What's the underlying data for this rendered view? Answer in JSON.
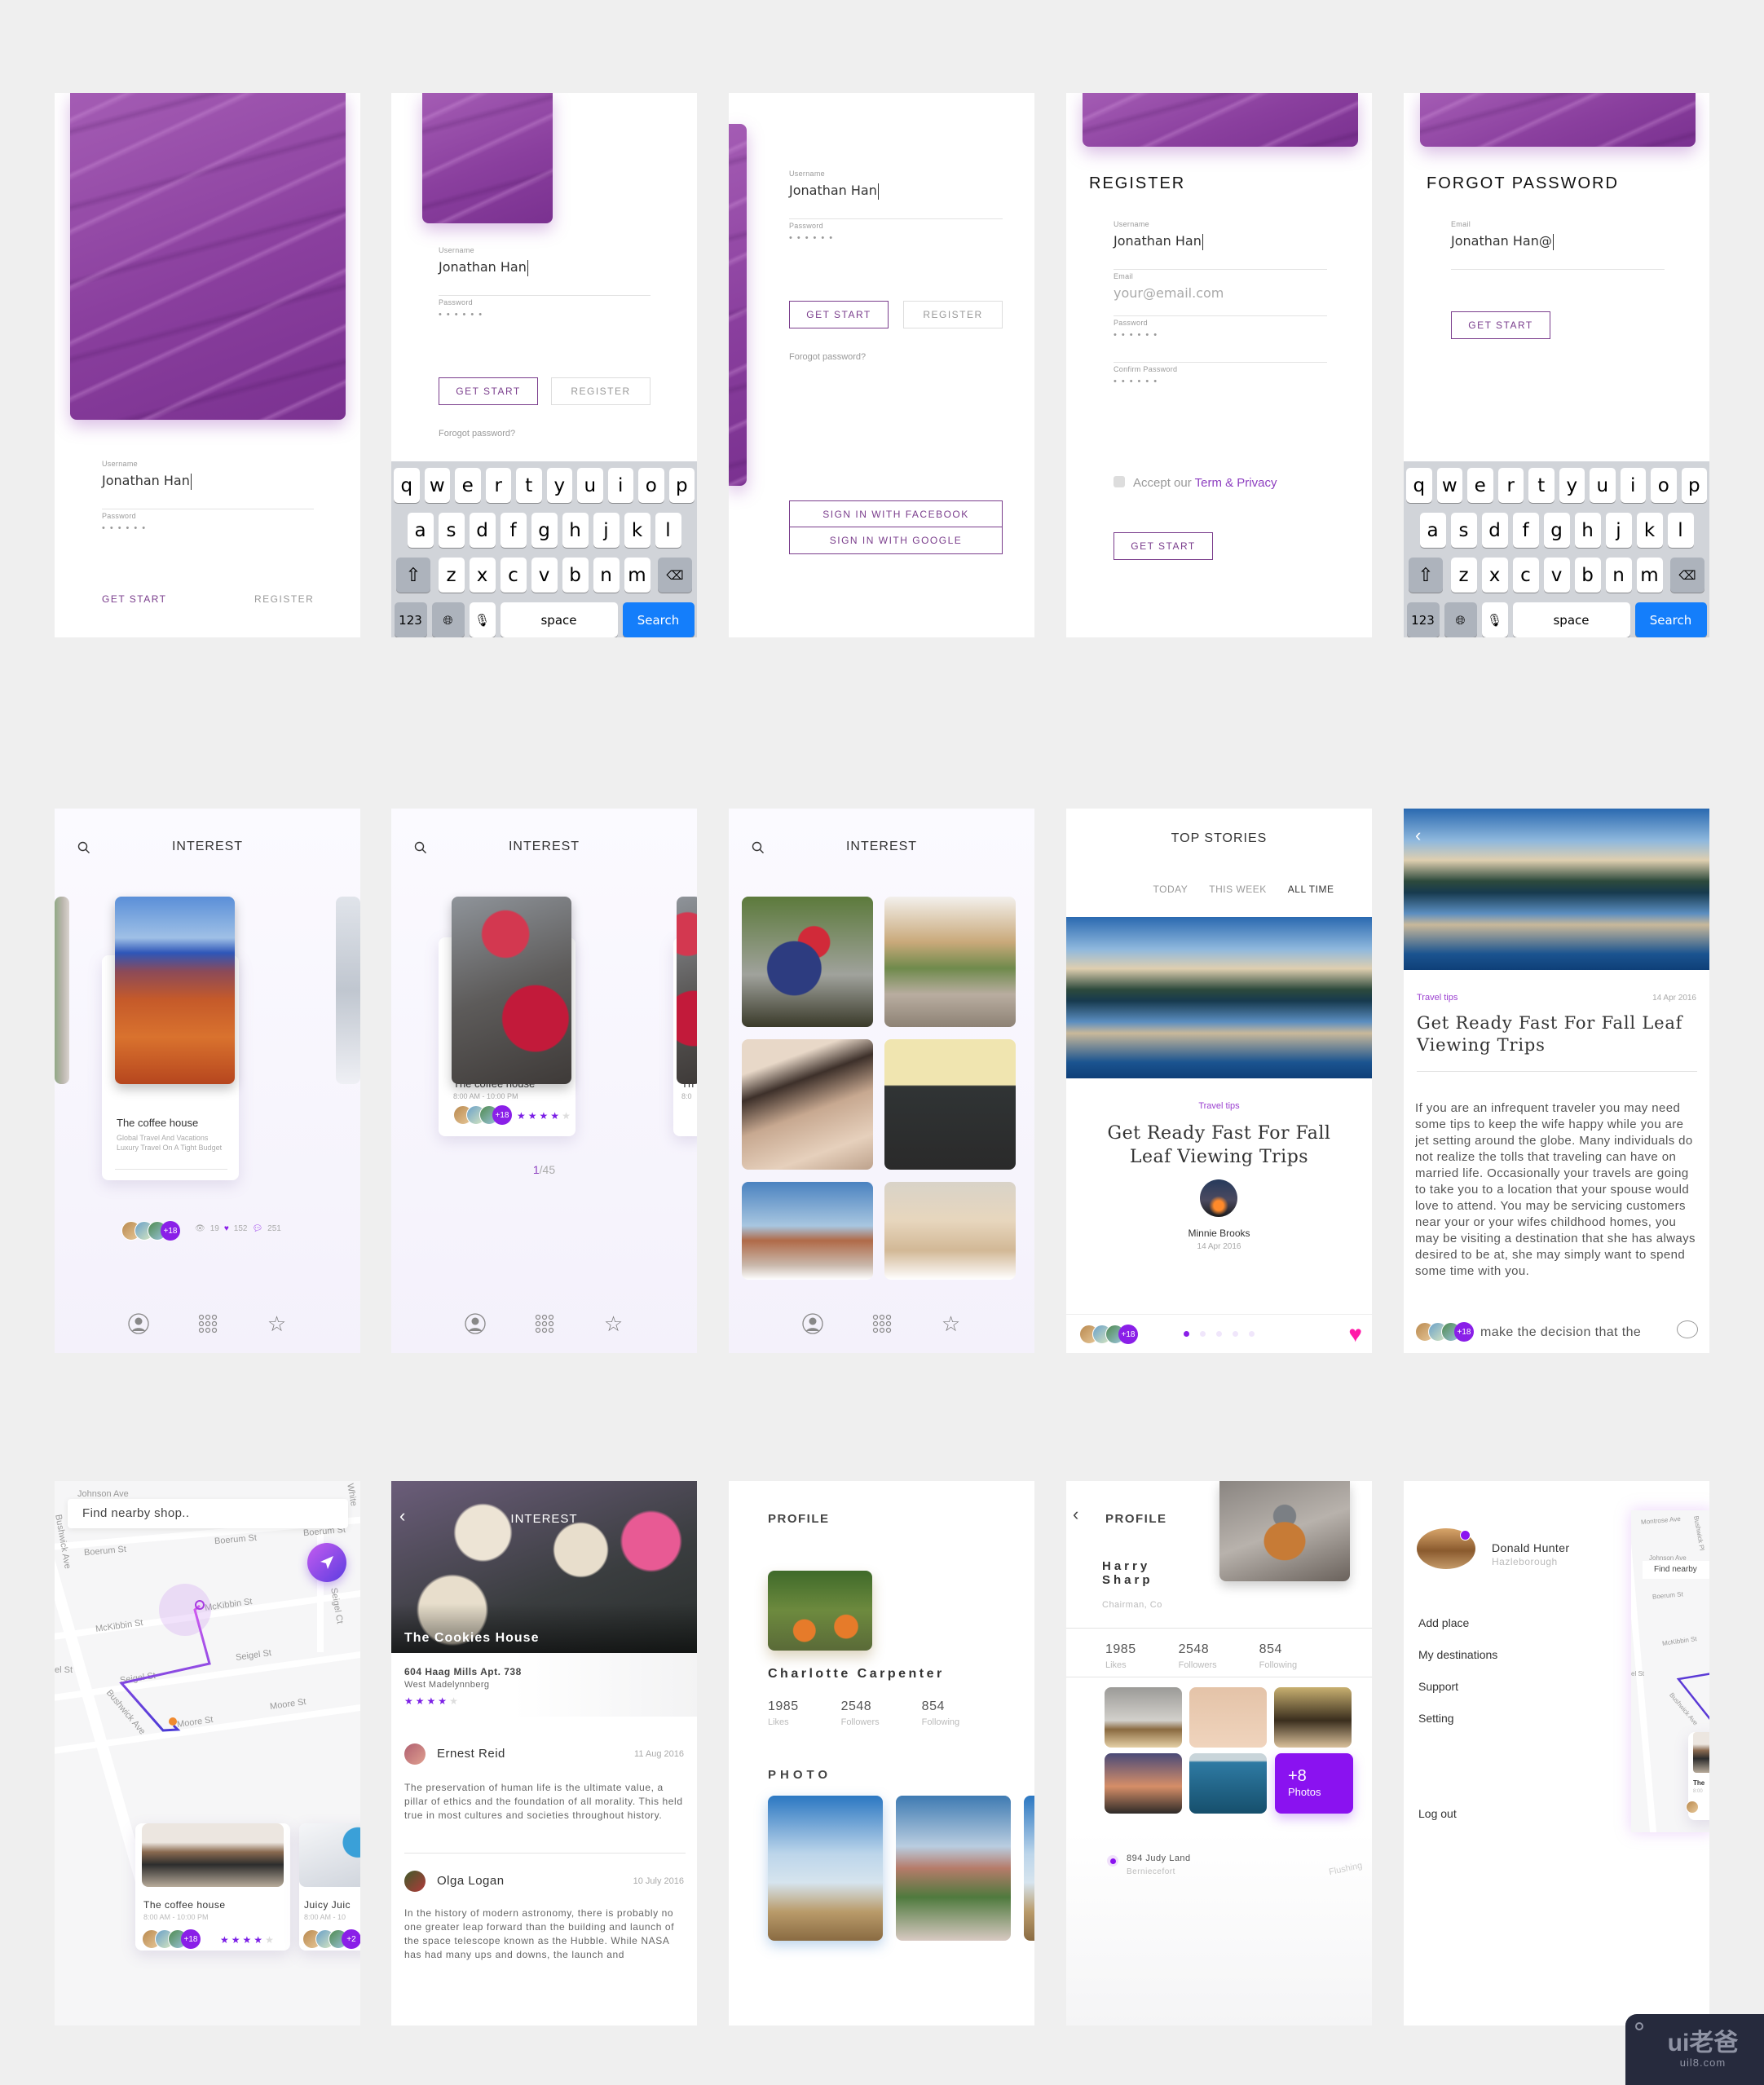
{
  "login_screen": {
    "username_label": "Username",
    "username_value": "Jonathan Han",
    "password_label": "Password",
    "password_mask": "••••••",
    "get_start": "GET START",
    "register": "REGISTER"
  },
  "login_keyboard_screen": {
    "username_label": "Username",
    "username_value": "Jonathan Han",
    "password_label": "Password",
    "password_mask": "••••••",
    "get_start": "GET START",
    "register": "REGISTER",
    "forgot": "Forogot password?"
  },
  "social_login_screen": {
    "username_label": "Username",
    "username_value": "Jonathan Han",
    "password_label": "Password",
    "password_mask": "••••••",
    "get_start": "GET START",
    "register": "REGISTER",
    "forgot": "Forogot password?",
    "facebook": "SIGN IN WITH FACEBOOK",
    "google": "SIGN IN WITH GOOGLE"
  },
  "register_screen": {
    "title": "REGISTER",
    "username_label": "Username",
    "username_value": "Jonathan Han",
    "email_label": "Email",
    "email_placeholder": "your@email.com",
    "password_label": "Password",
    "password_mask": "••••••",
    "confirm_label": "Confirm Password",
    "confirm_mask": "••••••",
    "accept_text": "Accept our ",
    "terms_link": "Term & Privacy",
    "get_start": "GET START"
  },
  "forgot_screen": {
    "title": "FORGOT PASSWORD",
    "email_label": "Email",
    "email_value": "Jonathan Han@",
    "get_start": "GET START"
  },
  "keyboard": {
    "row1": [
      "q",
      "w",
      "e",
      "r",
      "t",
      "y",
      "u",
      "i",
      "o",
      "p"
    ],
    "row2": [
      "a",
      "s",
      "d",
      "f",
      "g",
      "h",
      "j",
      "k",
      "l"
    ],
    "row3": [
      "z",
      "x",
      "c",
      "v",
      "b",
      "n",
      "m"
    ],
    "numbers": "123",
    "space": "space",
    "search": "Search"
  },
  "interest_carousel": {
    "title": "INTEREST",
    "card_title": "The coffee house",
    "card_desc": "Global Travel And Vacations Luxury Travel On A Tight Budget",
    "plus_count": "+18",
    "views": "19",
    "likes": "152",
    "comments": "251"
  },
  "interest_carousel2": {
    "title": "INTEREST",
    "card_title": "The coffee house",
    "card_hours": "8:00 AM - 10:00 PM",
    "plus_count": "+18",
    "rating": 4,
    "rating_max": 5,
    "peek_title": "Th",
    "peek_hours": "8:0",
    "pager_current": "1",
    "pager_total": "/45"
  },
  "interest_grid": {
    "title": "INTEREST"
  },
  "top_stories": {
    "title": "TOP STORIES",
    "tabs": [
      "TODAY",
      "THIS WEEK",
      "ALL TIME"
    ],
    "active_tab": "ALL TIME",
    "category": "Travel tips",
    "headline": "Get Ready Fast For Fall Leaf Viewing Trips",
    "author": "Minnie Brooks",
    "date": "14 Apr 2016",
    "plus_count": "+18",
    "page_dots": 5,
    "active_dot": 1
  },
  "article": {
    "category": "Travel tips",
    "date": "14 Apr 2016",
    "headline": "Get Ready Fast For Fall Leaf Viewing Trips",
    "body": "If you are an infrequent traveler you may need some tips to keep the wife happy while you are jet setting around the globe. Many individuals do not realize the tolls that traveling can have on married life. Occasionally your travels are going to take you to a location that your spouse would love to attend. You may be servicing customers near your or your wifes childhood homes, you may be visiting a destination that she has always desired to be at, she may simply want to spend some time with you.",
    "footer_text": "make the decision that the",
    "plus_count": "+18"
  },
  "map_screen": {
    "search_placeholder": "Find nearby shop..",
    "streets": [
      "Johnson Ave",
      "Boerum St",
      "Boerum St",
      "Boerum St",
      "McKibbin St",
      "McKibbin St",
      "Seigel St",
      "Seigel St",
      "el St",
      "Moore St",
      "Moore St",
      "Bushwick Ave",
      "Bushwick Ave",
      "Seigel Ct",
      "White"
    ],
    "cards": [
      {
        "title": "The coffee house",
        "hours": "8:00 AM - 10:00 PM",
        "plus": "+18",
        "rating": 4
      },
      {
        "title": "Juicy Juic",
        "hours": "8:00 AM - 10",
        "plus": "+2"
      }
    ]
  },
  "place_detail": {
    "header": "INTEREST",
    "place_name": "The Cookies House",
    "address_line1": "604 Haag Mills Apt. 738",
    "address_line2": "West Madelynnberg",
    "rating": 4,
    "reviews": [
      {
        "name": "Ernest Reid",
        "date": "11 Aug 2016",
        "text": "The preservation of human life is the ultimate value, a pillar of ethics and the foundation of all morality. This held true in most cultures and societies throughout history."
      },
      {
        "name": "Olga Logan",
        "date": "10 July 2016",
        "text": "In the history of modern astronomy, there is probably no one greater leap forward than the building and launch of the space telescope known as the Hubble. While NASA has had many ups and downs, the launch and"
      }
    ]
  },
  "profile1": {
    "title": "PROFILE",
    "name": "Charlotte Carpenter",
    "stats": [
      {
        "value": "1985",
        "label": "Likes"
      },
      {
        "value": "2548",
        "label": "Followers"
      },
      {
        "value": "854",
        "label": "Following"
      }
    ],
    "photo_heading": "PHOTO"
  },
  "profile2": {
    "title": "PROFILE",
    "first_name": "Harry",
    "last_name": "Sharp",
    "role": "Chairman, Co",
    "stats": [
      {
        "value": "1985",
        "label": "Likes"
      },
      {
        "value": "2548",
        "label": "Followers"
      },
      {
        "value": "854",
        "label": "Following"
      }
    ],
    "more_count": "+8",
    "more_label": "Photos",
    "address_line1": "894 Judy Land",
    "address_line2": "Berniecefort",
    "map_label": "Flushing"
  },
  "side_menu": {
    "name": "Donald Hunter",
    "location": "Hazleborough",
    "items": [
      "Add place",
      "My destinations",
      "Support",
      "Setting"
    ],
    "logout": "Log out",
    "peek_search": "Find nearby",
    "peek_streets": [
      "Montrose Ave",
      "Johnson Ave",
      "Boerum St",
      "McKibbin St",
      "el St",
      "Bushwick Ave",
      "Bushwick Pl"
    ],
    "peek_card_title": "The",
    "peek_card_hours": "8:00"
  },
  "watermark": {
    "brand": "ui老爸",
    "url": "uil8.com"
  },
  "colors": {
    "accent": "#8a1fe8",
    "brand_plum": "#7a3d8c",
    "link_purple": "#8d3fc0",
    "ios_blue": "#147efb",
    "heart_pink": "#ff1aa8",
    "background": "#efefef"
  }
}
